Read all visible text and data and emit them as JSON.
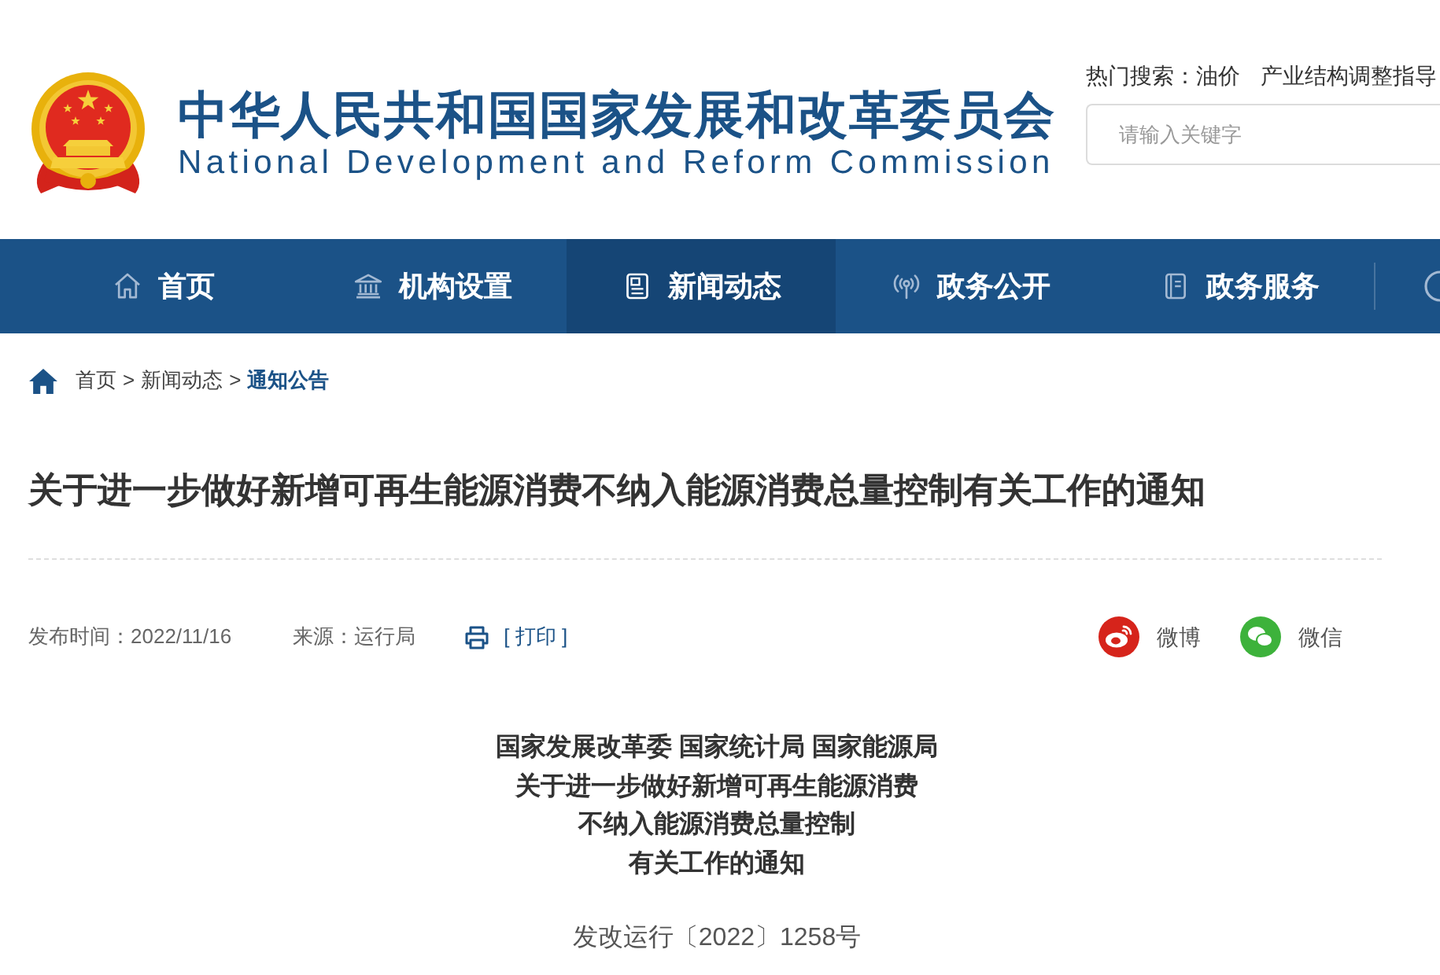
{
  "header": {
    "title": "中华人民共和国国家发展和改革委员会",
    "subtitle": "National Development and Reform Commission",
    "hot_search": {
      "label": "热门搜索：",
      "links": [
        "油价",
        "产业结构调整指导"
      ]
    },
    "search": {
      "placeholder": "请输入关键字"
    }
  },
  "nav": {
    "items": [
      {
        "label": "首页",
        "selected": false
      },
      {
        "label": "机构设置",
        "selected": false
      },
      {
        "label": "新闻动态",
        "selected": true
      },
      {
        "label": "政务公开",
        "selected": false
      },
      {
        "label": "政务服务",
        "selected": false
      }
    ]
  },
  "breadcrumb": {
    "items": [
      {
        "label": "首页",
        "current": false
      },
      {
        "label": "新闻动态",
        "current": false
      },
      {
        "label": "通知公告",
        "current": true
      }
    ],
    "separators": [
      ">",
      ">"
    ]
  },
  "article": {
    "title": "关于进一步做好新增可再生能源消费不纳入能源消费总量控制有关工作的通知",
    "published": "发布时间：2022/11/16",
    "source": "来源：运行局",
    "print": "[ 打印 ]",
    "share": [
      {
        "label": "微博"
      },
      {
        "label": "微信"
      }
    ],
    "heading_lines": [
      "国家发展改革委 国家统计局 国家能源局",
      "关于进一步做好新增可再生能源消费",
      "不纳入能源消费总量控制",
      "有关工作的通知"
    ],
    "doc_number": "发改运行〔2022〕1258号"
  }
}
